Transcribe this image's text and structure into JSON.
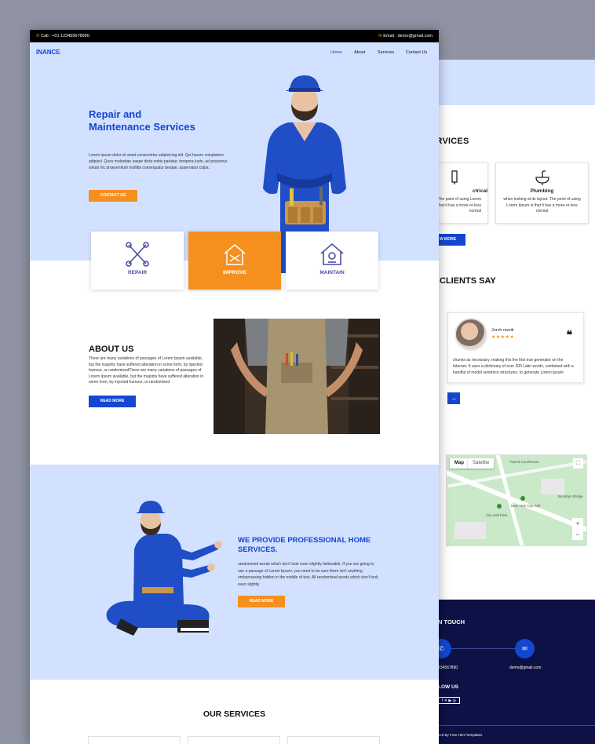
{
  "back": {
    "services_title": "ERVICES",
    "cards": [
      {
        "title": "ctrical",
        "text": "layout. The point of using Lorem Ipsum is that it has a more-or-less normal"
      },
      {
        "title": "Plumbing",
        "text": "when looking at its layout. The point of using Lorem Ipsum is that it has a more-or-less normal"
      }
    ],
    "read_more": "W MORE",
    "clients_title": "CLIENTS SAY",
    "testimonial": {
      "name": "Jorch morik",
      "stars": "★★★★★",
      "quote_mark": "❝",
      "text": "chunks as necessary, making this the first true generator on the Internet. It uses a dictionary of over 200 Latin words, combined with a handful of model sentence structures, to generate Lorem Ipsum"
    },
    "next_arrow": "→",
    "map": {
      "tab_map": "Map",
      "tab_satellite": "Satellite",
      "fullscreen": "⛶",
      "zoom_in": "+",
      "zoom_out": "−",
      "labels": [
        "New York City Hall",
        "Tweed Courthouse",
        "City Hall Park",
        "Brooklyn Bridge"
      ]
    },
    "footer": {
      "touch": "N TOUCH",
      "phone_icon": "✆",
      "mail_icon": "✉",
      "phone": "234567890",
      "email": "demo@gmail.com",
      "follow": "LOW US",
      "social": "f ✕ ▶ ◎",
      "copyright": "ved By Free Html Templates"
    }
  },
  "front": {
    "topbar": {
      "call": "Call : +01 123455678990",
      "email": "Email : demo@gmail.com"
    },
    "logo": "INANCE",
    "nav": {
      "home": "Home",
      "about": "About",
      "services": "Services",
      "contact": "Contact Us"
    },
    "hero": {
      "title": "Repair and Maintenance Services",
      "text": "Lorem ipsum dolor sit amet consectetur adipisicing elit. Qui harum voluptatem adipisci. Quos molestiae saepe dicta nobis pariatur, tempora iusto, ad possimus soluta hic praesentium mollitia consequatur beatae, aspernatur culpa.",
      "button": "CONTACT US"
    },
    "features": [
      {
        "label": "REPAIR",
        "icon": "wrench-cross-icon"
      },
      {
        "label": "IMPROVE",
        "icon": "house-tools-icon"
      },
      {
        "label": "MAINTAIN",
        "icon": "house-maintain-icon"
      }
    ],
    "about": {
      "title": "ABOUT US",
      "text": "There are many variations of passages of Lorem Ipsum available, but the majority have suffered alteration in some form, by injected humour, or randomisedThere are many variations of passages of Lorem Ipsum available, but the majority have suffered alteration in some form, by injected humour, or randomised",
      "button": "READ MORE"
    },
    "provide": {
      "title": "WE PROVIDE PROFESSIONAL HOME SERVICES.",
      "text": "randomised words which don't look even slightly believable. If you are going to use a passage of Lorem Ipsum, you need to be sure there isn't anything embarrassing hidden in the middle of text. All randomised words which don't look even slightly",
      "button": "READ MORE"
    },
    "our_services": "OUR SERVICES"
  },
  "colors": {
    "blue": "#1346d1",
    "orange": "#f5901f",
    "hero_bg": "#d2e1ff",
    "footer_bg": "#0d1145"
  }
}
